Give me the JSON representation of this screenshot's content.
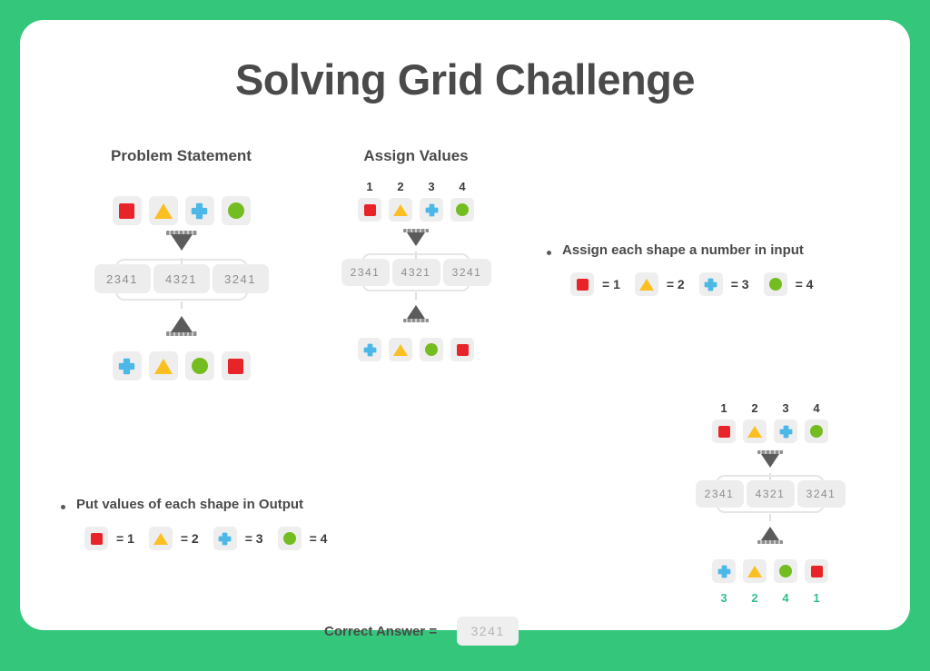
{
  "theme": {
    "background": "#34c77b",
    "card": "#ffffff",
    "text": "#4a4a4a",
    "tile": "#eeeeee",
    "value_text": "#8d8d8d",
    "answer_green": "#33c08a",
    "shape_colors": {
      "square": "#e8242a",
      "triangle": "#fcbf21",
      "cross": "#4bb8e8",
      "circle": "#74bd20"
    }
  },
  "title": "Solving Grid Challenge",
  "problem_statement": {
    "heading": "Problem Statement",
    "input_shapes": [
      "square",
      "triangle",
      "cross",
      "circle"
    ],
    "values": [
      "2341",
      "4321",
      "3241"
    ],
    "output_shapes": [
      "cross",
      "triangle",
      "circle",
      "square"
    ],
    "funnel_top_icon": "funnel-down-icon",
    "funnel_bottom_icon": "funnel-up-icon"
  },
  "assign_values": {
    "heading": "Assign Values",
    "numbers": [
      "1",
      "2",
      "3",
      "4"
    ],
    "input_shapes": [
      "square",
      "triangle",
      "cross",
      "circle"
    ],
    "values": [
      "2341",
      "4321",
      "3241"
    ],
    "output_shapes": [
      "cross",
      "triangle",
      "circle",
      "square"
    ]
  },
  "bullet_assign": {
    "text": "Assign each shape a number in input",
    "legend": [
      {
        "shape": "square",
        "eq": "= 1"
      },
      {
        "shape": "triangle",
        "eq": "= 2"
      },
      {
        "shape": "cross",
        "eq": "= 3"
      },
      {
        "shape": "circle",
        "eq": "= 4"
      }
    ]
  },
  "bullet_output": {
    "text": "Put values of each shape in Output",
    "legend": [
      {
        "shape": "square",
        "eq": "= 1"
      },
      {
        "shape": "triangle",
        "eq": "= 2"
      },
      {
        "shape": "cross",
        "eq": "= 3"
      },
      {
        "shape": "circle",
        "eq": "= 4"
      }
    ]
  },
  "solution": {
    "numbers": [
      "1",
      "2",
      "3",
      "4"
    ],
    "input_shapes": [
      "square",
      "triangle",
      "cross",
      "circle"
    ],
    "values": [
      "2341",
      "4321",
      "3241"
    ],
    "output_shapes": [
      "cross",
      "triangle",
      "circle",
      "square"
    ],
    "output_numbers": [
      "3",
      "2",
      "4",
      "1"
    ]
  },
  "correct_answer": {
    "label": "Correct Answer =",
    "value": "3241"
  }
}
